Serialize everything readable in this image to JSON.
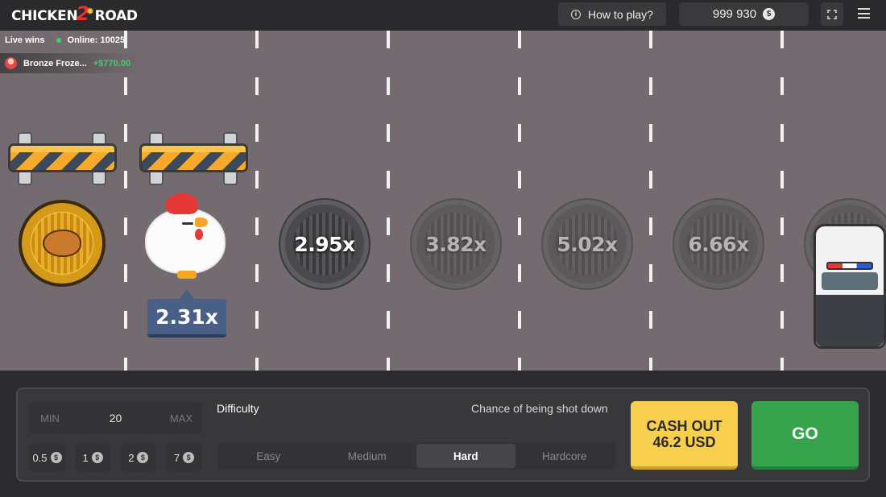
{
  "header": {
    "logo_left": "CHICKEN",
    "logo_num": "2",
    "logo_right": "ROAD",
    "how_to_play": "How to play?",
    "balance": "999 930",
    "currency_icon": "$"
  },
  "live": {
    "title": "Live wins",
    "online": "Online: 10025",
    "recent_player": "Bronze Froze...",
    "recent_amount": "+$770.00"
  },
  "road": {
    "current_multiplier": "2.31x",
    "lanes": [
      {
        "multiplier": "2.95x"
      },
      {
        "multiplier": "3.82x"
      },
      {
        "multiplier": "5.02x"
      },
      {
        "multiplier": "6.66x"
      }
    ]
  },
  "controls": {
    "min": "MIN",
    "bet": "20",
    "max": "MAX",
    "chips": [
      "0.5",
      "1",
      "2",
      "7"
    ],
    "chip_currency": "$",
    "difficulty_label": "Difficulty",
    "chance_label": "Chance of being shot down",
    "difficulties": [
      "Easy",
      "Medium",
      "Hard",
      "Hardcore"
    ],
    "selected_difficulty": "Hard",
    "cashout_line1": "CASH OUT",
    "cashout_line2": "46.2 USD",
    "go": "GO"
  },
  "colors": {
    "road": "#736b6f",
    "cashout": "#f8cf4c",
    "go": "#36a34d",
    "online": "#3bd16f",
    "multiplier_tag": "#4a5f86"
  }
}
